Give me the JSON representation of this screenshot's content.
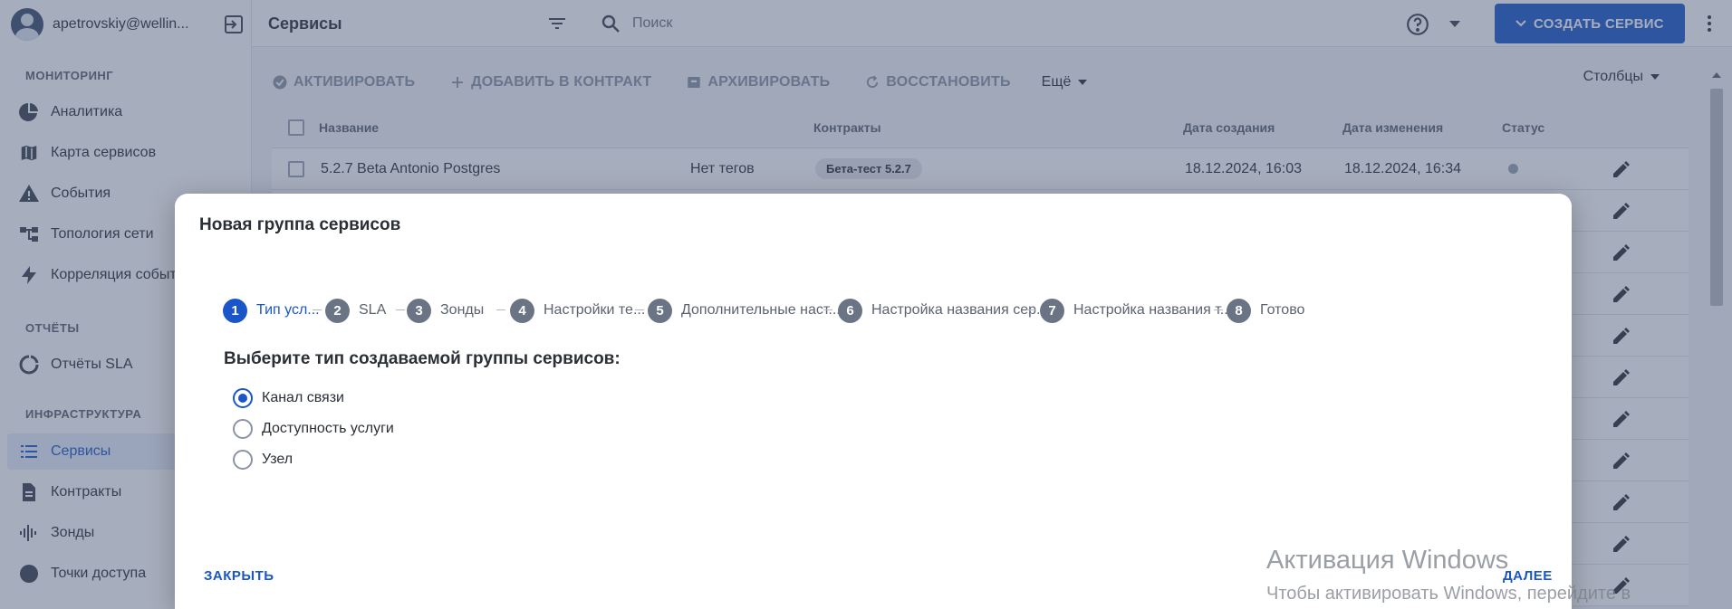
{
  "sidebar": {
    "user_email": "apetrovskiy@wellin...",
    "sections": {
      "monitoring": "МОНИТОРИНГ",
      "reports": "ОТЧЁТЫ",
      "infrastructure": "ИНФРАСТРУКТУРА"
    },
    "items": [
      {
        "label": "Аналитика",
        "icon": "pie-chart-icon"
      },
      {
        "label": "Карта сервисов",
        "icon": "map-icon"
      },
      {
        "label": "События",
        "icon": "warning-icon"
      },
      {
        "label": "Топология сети",
        "icon": "topology-icon"
      },
      {
        "label": "Корреляция событий",
        "icon": "lightning-icon"
      },
      {
        "label": "Отчёты SLA",
        "icon": "refresh-chart-icon"
      },
      {
        "label": "Сервисы",
        "icon": "list-icon",
        "active": true
      },
      {
        "label": "Контракты",
        "icon": "document-icon"
      },
      {
        "label": "Зонды",
        "icon": "waveform-icon"
      },
      {
        "label": "Точки доступа",
        "icon": "circle-icon"
      }
    ]
  },
  "header": {
    "title": "Сервисы",
    "search_placeholder": "Поиск",
    "create_button": "СОЗДАТЬ СЕРВИС"
  },
  "toolbar": {
    "activate": "АКТИВИРОВАТЬ",
    "add_to_contract": "ДОБАВИТЬ В КОНТРАКТ",
    "archive": "АРХИВИРОВАТЬ",
    "restore": "ВОССТАНОВИТЬ",
    "more": "Ещё",
    "columns": "Столбцы"
  },
  "table": {
    "columns": {
      "name": "Название",
      "contracts": "Контракты",
      "created": "Дата создания",
      "modified": "Дата изменения",
      "status": "Статус"
    },
    "rows": [
      {
        "name": "5.2.7 Beta Antonio Postgres",
        "tags": "Нет тегов",
        "contract": "Бета-тест 5.2.7",
        "created": "18.12.2024, 16:03",
        "modified": "18.12.2024, 16:34"
      }
    ]
  },
  "modal": {
    "title": "Новая группа сервисов",
    "steps": [
      {
        "num": "1",
        "label": "Тип усл...",
        "active": true
      },
      {
        "num": "2",
        "label": "SLA"
      },
      {
        "num": "3",
        "label": "Зонды"
      },
      {
        "num": "4",
        "label": "Настройки те..."
      },
      {
        "num": "5",
        "label": "Дополнительные наст..."
      },
      {
        "num": "6",
        "label": "Настройка названия сер..."
      },
      {
        "num": "7",
        "label": "Настройка названия т..."
      },
      {
        "num": "8",
        "label": "Готово"
      }
    ],
    "question": "Выберите тип создаваемой группы сервисов:",
    "options": [
      {
        "label": "Канал связи",
        "checked": true
      },
      {
        "label": "Доступность услуги",
        "checked": false
      },
      {
        "label": "Узел",
        "checked": false
      }
    ],
    "close_button": "ЗАКРЫТЬ",
    "next_button": "ДАЛЕЕ"
  },
  "watermark": {
    "line1": "Активация Windows",
    "line2": "Чтобы активировать Windows, перейдите в"
  },
  "colors": {
    "accent": "#1a56c7",
    "overlay": "#465474",
    "step_inactive": "#6b7485"
  }
}
